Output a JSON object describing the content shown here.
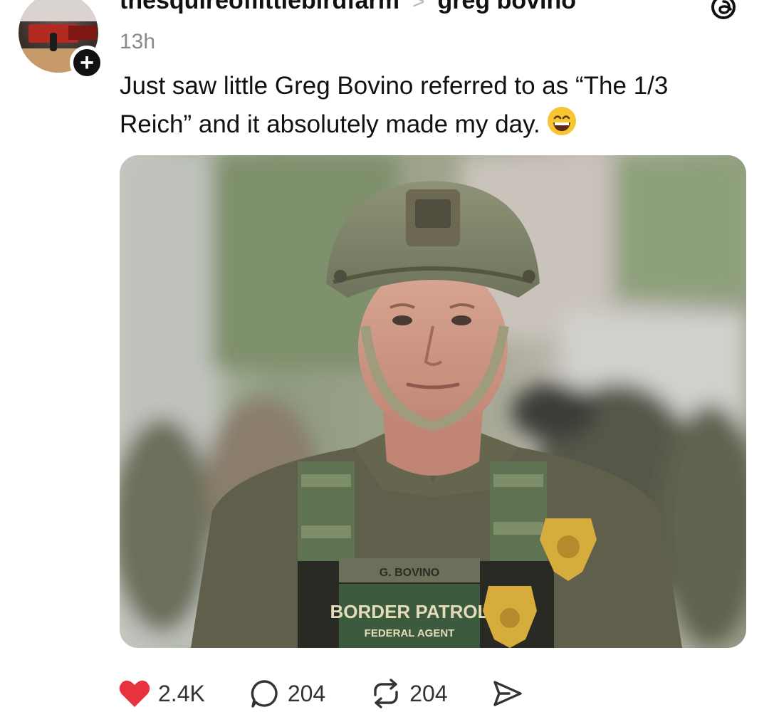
{
  "post": {
    "username": "thesquireoflittlebirdfarm",
    "separator": ">",
    "topic": "greg bovino",
    "time": "13h",
    "text": "Just saw little Greg Bovino referred to as “The 1/3 Reich” and it absolutely made my day.",
    "emoji": "grinning-face-emoji"
  },
  "photo": {
    "name_tape": "G. BOVINO",
    "patch_line1": "BORDER PATROL",
    "patch_line2": "FEDERAL AGENT"
  },
  "actions": {
    "likes": "2.4K",
    "comments": "204",
    "reposts": "204"
  },
  "icons": {
    "like": "heart-icon",
    "comment": "comment-icon",
    "repost": "repost-icon",
    "share": "send-icon",
    "app": "threads-icon",
    "follow": "plus-icon"
  },
  "colors": {
    "like": "#e8323f",
    "text": "#111111",
    "muted": "#8a8a8a"
  }
}
